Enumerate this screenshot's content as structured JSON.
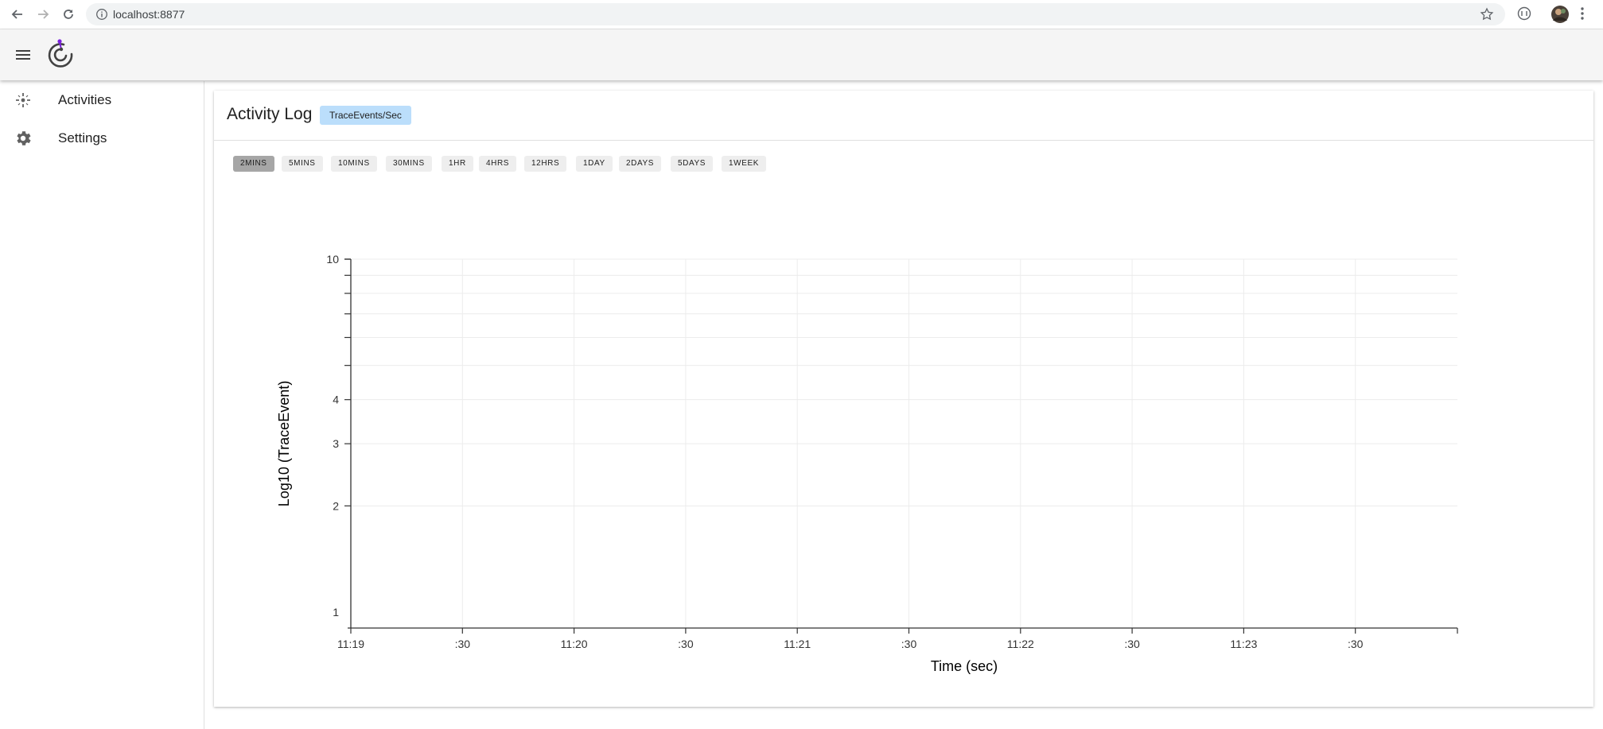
{
  "browser": {
    "url": "localhost:8877"
  },
  "sidebar": {
    "items": [
      {
        "label": "Activities",
        "icon": "activities-icon"
      },
      {
        "label": "Settings",
        "icon": "gear-icon"
      }
    ]
  },
  "main": {
    "title": "Activity Log",
    "metric_chip": "TraceEvents/Sec",
    "ranges": [
      "2MINS",
      "5MINS",
      "10MINS",
      "30MINS",
      "1HR",
      "4HRS",
      "12HRS",
      "1DAY",
      "2DAYS",
      "5DAYS",
      "1WEEK"
    ],
    "selected_range": "2MINS"
  },
  "colors": {
    "chip": "#bbdefb",
    "selected_range": "#a6a6a6",
    "logo_accent": "#7b1fe0"
  },
  "chart_data": {
    "type": "line",
    "series": [],
    "xlabel": "Time (sec)",
    "ylabel": "Log10 (TraceEvent)",
    "x_ticks": [
      "11:19",
      ":30",
      "11:20",
      ":30",
      "11:21",
      ":30",
      "11:22",
      ":30",
      "11:23",
      ":30"
    ],
    "y_scale": "log",
    "y_ticks": [
      "1",
      "2",
      "3",
      "4",
      "10"
    ],
    "ylim": [
      1,
      10
    ],
    "grid": true
  }
}
